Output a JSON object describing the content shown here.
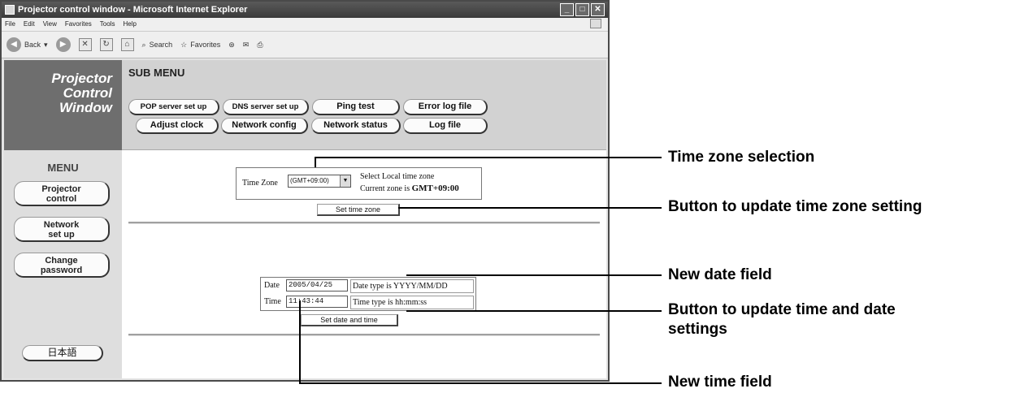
{
  "window": {
    "title": "Projector control window - Microsoft Internet Explorer",
    "controls": [
      "_",
      "□",
      "✕"
    ]
  },
  "menubar": [
    "File",
    "Edit",
    "View",
    "Favorites",
    "Tools",
    "Help"
  ],
  "toolbar": {
    "back": "Back",
    "search": "Search",
    "favorites": "Favorites"
  },
  "brand": {
    "line1": "Projector",
    "line2": "Control",
    "line3": "Window"
  },
  "sub_menu": {
    "title": "SUB MENU",
    "buttons": [
      "POP server set up",
      "DNS server set up",
      "Ping test",
      "Error log file",
      "Adjust clock",
      "Network config",
      "Network status",
      "Log file"
    ]
  },
  "menu": {
    "title": "MENU",
    "projector_control": [
      "Projector",
      "control"
    ],
    "network_setup": [
      "Network",
      "set up"
    ],
    "change_password": [
      "Change",
      "password"
    ],
    "language": "日本語"
  },
  "timezone": {
    "label": "Time Zone",
    "selected": "(GMT+09:00)",
    "hint": "Select Local time zone",
    "current_prefix": "Current zone is",
    "current_value": "GMT+09:00",
    "button": "Set time zone"
  },
  "datetime": {
    "date_label": "Date",
    "date_value": "2005/04/25",
    "date_hint": "Date type is YYYY/MM/DD",
    "time_label": "Time",
    "time_value": "11:43:44",
    "time_hint": "Time type is hh:mm:ss",
    "button": "Set date and time"
  },
  "callouts": {
    "time_zone_selection": "Time zone selection",
    "update_time_zone": "Button to update time zone setting",
    "new_date_field": "New date field",
    "update_datetime_line1": "Button to update time and date",
    "update_datetime_line2": "settings",
    "new_time_field": "New time field"
  }
}
